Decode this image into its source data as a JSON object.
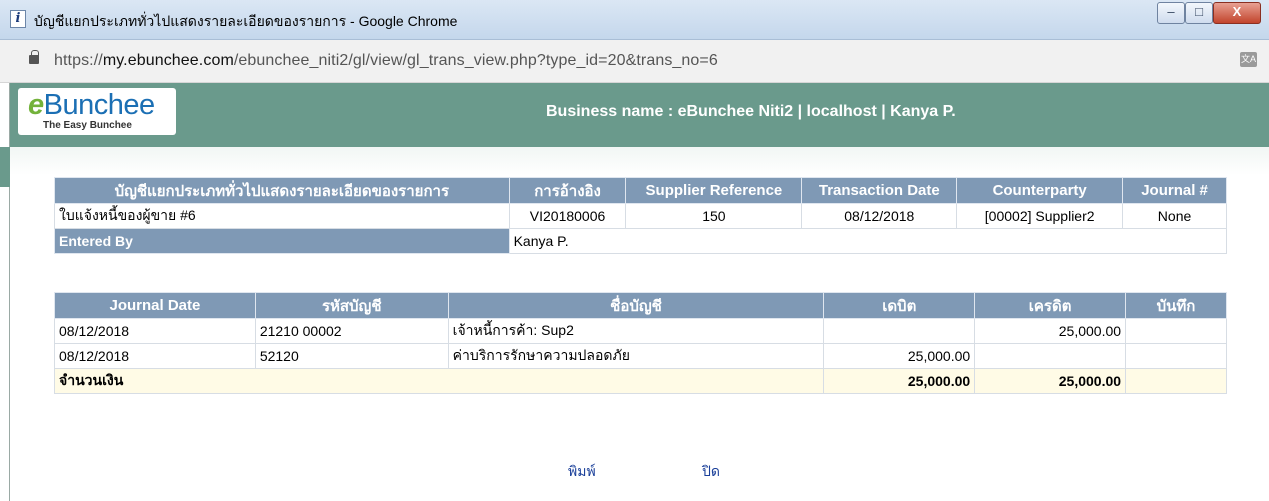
{
  "window": {
    "title_icon": "i",
    "title": "บัญชีแยกประเภททั่วไปแสดงรายละเอียดของรายการ - Google Chrome",
    "min_icon": "–",
    "max_icon": "□",
    "close_icon": "X"
  },
  "address": {
    "url_prefix": "https://",
    "url_host": "my.ebunchee.com",
    "url_path": "/ebunchee_niti2/gl/view/gl_trans_view.php?type_id=20&trans_no=6",
    "translate_icon": "文A"
  },
  "header": {
    "logo_e": "e",
    "logo_text": "Bunchee",
    "logo_sub": "The Easy Bunchee",
    "business": "Business name : eBunchee Niti2 | localhost | Kanya P."
  },
  "summary": {
    "headers": [
      "บัญชีแยกประเภททั่วไปแสดงรายละเอียดของรายการ",
      "การอ้างอิง",
      "Supplier Reference",
      "Transaction Date",
      "Counterparty",
      "Journal #"
    ],
    "row": [
      "ใบแจ้งหนี้ของผู้ขาย #6",
      "VI20180006",
      "150",
      "08/12/2018",
      "[00002] Supplier2",
      "None"
    ],
    "entered_by_label": "Entered By",
    "entered_by_value": "Kanya P."
  },
  "journal": {
    "headers": [
      "Journal Date",
      "รหัสบัญชี",
      "ชื่อบัญชี",
      "เดบิต",
      "เครดิต",
      "บันทึก"
    ],
    "rows": [
      [
        "08/12/2018",
        "21210 00002",
        "เจ้าหนี้การค้า: Sup2",
        "",
        "25,000.00",
        ""
      ],
      [
        "08/12/2018",
        "52120",
        "ค่าบริการรักษาความปลอดภัย",
        "25,000.00",
        "",
        ""
      ]
    ],
    "total_label": "จำนวนเงิน",
    "total_debit": "25,000.00",
    "total_credit": "25,000.00"
  },
  "actions": {
    "print": "พิมพ์",
    "close": "ปิด"
  }
}
